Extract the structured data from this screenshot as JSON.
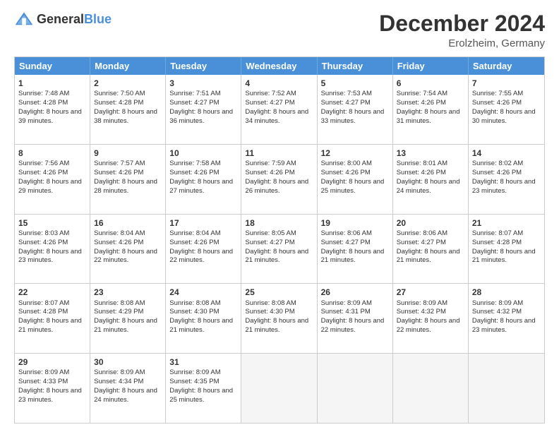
{
  "header": {
    "logo_general": "General",
    "logo_blue": "Blue",
    "month_title": "December 2024",
    "location": "Erolzheim, Germany"
  },
  "days_of_week": [
    "Sunday",
    "Monday",
    "Tuesday",
    "Wednesday",
    "Thursday",
    "Friday",
    "Saturday"
  ],
  "weeks": [
    [
      {
        "day": "1",
        "sunrise": "Sunrise: 7:48 AM",
        "sunset": "Sunset: 4:28 PM",
        "daylight": "Daylight: 8 hours and 39 minutes."
      },
      {
        "day": "2",
        "sunrise": "Sunrise: 7:50 AM",
        "sunset": "Sunset: 4:28 PM",
        "daylight": "Daylight: 8 hours and 38 minutes."
      },
      {
        "day": "3",
        "sunrise": "Sunrise: 7:51 AM",
        "sunset": "Sunset: 4:27 PM",
        "daylight": "Daylight: 8 hours and 36 minutes."
      },
      {
        "day": "4",
        "sunrise": "Sunrise: 7:52 AM",
        "sunset": "Sunset: 4:27 PM",
        "daylight": "Daylight: 8 hours and 34 minutes."
      },
      {
        "day": "5",
        "sunrise": "Sunrise: 7:53 AM",
        "sunset": "Sunset: 4:27 PM",
        "daylight": "Daylight: 8 hours and 33 minutes."
      },
      {
        "day": "6",
        "sunrise": "Sunrise: 7:54 AM",
        "sunset": "Sunset: 4:26 PM",
        "daylight": "Daylight: 8 hours and 31 minutes."
      },
      {
        "day": "7",
        "sunrise": "Sunrise: 7:55 AM",
        "sunset": "Sunset: 4:26 PM",
        "daylight": "Daylight: 8 hours and 30 minutes."
      }
    ],
    [
      {
        "day": "8",
        "sunrise": "Sunrise: 7:56 AM",
        "sunset": "Sunset: 4:26 PM",
        "daylight": "Daylight: 8 hours and 29 minutes."
      },
      {
        "day": "9",
        "sunrise": "Sunrise: 7:57 AM",
        "sunset": "Sunset: 4:26 PM",
        "daylight": "Daylight: 8 hours and 28 minutes."
      },
      {
        "day": "10",
        "sunrise": "Sunrise: 7:58 AM",
        "sunset": "Sunset: 4:26 PM",
        "daylight": "Daylight: 8 hours and 27 minutes."
      },
      {
        "day": "11",
        "sunrise": "Sunrise: 7:59 AM",
        "sunset": "Sunset: 4:26 PM",
        "daylight": "Daylight: 8 hours and 26 minutes."
      },
      {
        "day": "12",
        "sunrise": "Sunrise: 8:00 AM",
        "sunset": "Sunset: 4:26 PM",
        "daylight": "Daylight: 8 hours and 25 minutes."
      },
      {
        "day": "13",
        "sunrise": "Sunrise: 8:01 AM",
        "sunset": "Sunset: 4:26 PM",
        "daylight": "Daylight: 8 hours and 24 minutes."
      },
      {
        "day": "14",
        "sunrise": "Sunrise: 8:02 AM",
        "sunset": "Sunset: 4:26 PM",
        "daylight": "Daylight: 8 hours and 23 minutes."
      }
    ],
    [
      {
        "day": "15",
        "sunrise": "Sunrise: 8:03 AM",
        "sunset": "Sunset: 4:26 PM",
        "daylight": "Daylight: 8 hours and 23 minutes."
      },
      {
        "day": "16",
        "sunrise": "Sunrise: 8:04 AM",
        "sunset": "Sunset: 4:26 PM",
        "daylight": "Daylight: 8 hours and 22 minutes."
      },
      {
        "day": "17",
        "sunrise": "Sunrise: 8:04 AM",
        "sunset": "Sunset: 4:26 PM",
        "daylight": "Daylight: 8 hours and 22 minutes."
      },
      {
        "day": "18",
        "sunrise": "Sunrise: 8:05 AM",
        "sunset": "Sunset: 4:27 PM",
        "daylight": "Daylight: 8 hours and 21 minutes."
      },
      {
        "day": "19",
        "sunrise": "Sunrise: 8:06 AM",
        "sunset": "Sunset: 4:27 PM",
        "daylight": "Daylight: 8 hours and 21 minutes."
      },
      {
        "day": "20",
        "sunrise": "Sunrise: 8:06 AM",
        "sunset": "Sunset: 4:27 PM",
        "daylight": "Daylight: 8 hours and 21 minutes."
      },
      {
        "day": "21",
        "sunrise": "Sunrise: 8:07 AM",
        "sunset": "Sunset: 4:28 PM",
        "daylight": "Daylight: 8 hours and 21 minutes."
      }
    ],
    [
      {
        "day": "22",
        "sunrise": "Sunrise: 8:07 AM",
        "sunset": "Sunset: 4:28 PM",
        "daylight": "Daylight: 8 hours and 21 minutes."
      },
      {
        "day": "23",
        "sunrise": "Sunrise: 8:08 AM",
        "sunset": "Sunset: 4:29 PM",
        "daylight": "Daylight: 8 hours and 21 minutes."
      },
      {
        "day": "24",
        "sunrise": "Sunrise: 8:08 AM",
        "sunset": "Sunset: 4:30 PM",
        "daylight": "Daylight: 8 hours and 21 minutes."
      },
      {
        "day": "25",
        "sunrise": "Sunrise: 8:08 AM",
        "sunset": "Sunset: 4:30 PM",
        "daylight": "Daylight: 8 hours and 21 minutes."
      },
      {
        "day": "26",
        "sunrise": "Sunrise: 8:09 AM",
        "sunset": "Sunset: 4:31 PM",
        "daylight": "Daylight: 8 hours and 22 minutes."
      },
      {
        "day": "27",
        "sunrise": "Sunrise: 8:09 AM",
        "sunset": "Sunset: 4:32 PM",
        "daylight": "Daylight: 8 hours and 22 minutes."
      },
      {
        "day": "28",
        "sunrise": "Sunrise: 8:09 AM",
        "sunset": "Sunset: 4:32 PM",
        "daylight": "Daylight: 8 hours and 23 minutes."
      }
    ],
    [
      {
        "day": "29",
        "sunrise": "Sunrise: 8:09 AM",
        "sunset": "Sunset: 4:33 PM",
        "daylight": "Daylight: 8 hours and 23 minutes."
      },
      {
        "day": "30",
        "sunrise": "Sunrise: 8:09 AM",
        "sunset": "Sunset: 4:34 PM",
        "daylight": "Daylight: 8 hours and 24 minutes."
      },
      {
        "day": "31",
        "sunrise": "Sunrise: 8:09 AM",
        "sunset": "Sunset: 4:35 PM",
        "daylight": "Daylight: 8 hours and 25 minutes."
      },
      null,
      null,
      null,
      null
    ]
  ]
}
